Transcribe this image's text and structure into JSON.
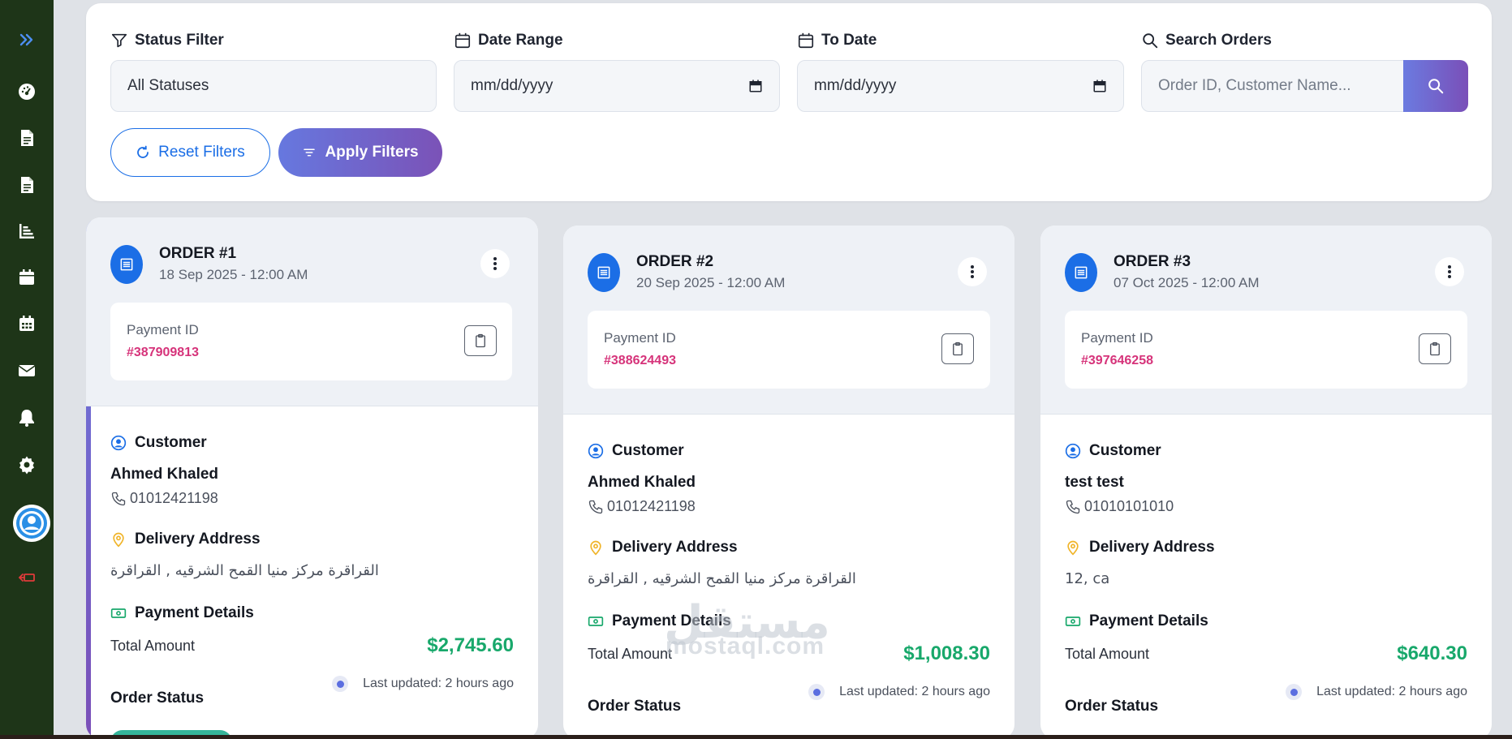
{
  "colors": {
    "sidebar_bg": "#1e3518",
    "primary_blue": "#1b6ee6",
    "gradient_start": "#6b7be0",
    "gradient_end": "#7a4fb8",
    "amount_green": "#18a86b",
    "payment_id_pink": "#d6337a"
  },
  "sidebar": {
    "icons": [
      "expand-icon",
      "dashboard-icon",
      "document-icon",
      "document-alt-icon",
      "chart-icon",
      "calendar-icon",
      "calendar-grid-icon",
      "mail-icon",
      "bell-icon",
      "settings-icon",
      "avatar",
      "logout-icon"
    ]
  },
  "filters": {
    "status_label": "Status Filter",
    "status_value": "All Statuses",
    "date_range_label": "Date Range",
    "date_range_placeholder": "mm/dd/yyyy",
    "to_date_label": "To Date",
    "to_date_placeholder": "mm/dd/yyyy",
    "search_label": "Search Orders",
    "search_placeholder": "Order ID, Customer Name...",
    "reset_label": "Reset Filters",
    "apply_label": "Apply Filters"
  },
  "orders": [
    {
      "title": "ORDER #1",
      "date": "18 Sep 2025 - 12:00 AM",
      "payment_label": "Payment ID",
      "payment_id": "#387909813",
      "customer_label": "Customer",
      "customer_name": "Ahmed Khaled",
      "phone": "01012421198",
      "address_label": "Delivery Address",
      "address": "القراقرة مركز منيا القمح الشرقيه , القراقرة",
      "payment_details_label": "Payment Details",
      "total_label": "Total Amount",
      "total": "$2,745.60",
      "updated": "Last updated: 2 hours ago",
      "status_label": "Order Status"
    },
    {
      "title": "ORDER #2",
      "date": "20 Sep 2025 - 12:00 AM",
      "payment_label": "Payment ID",
      "payment_id": "#388624493",
      "customer_label": "Customer",
      "customer_name": "Ahmed Khaled",
      "phone": "01012421198",
      "address_label": "Delivery Address",
      "address": "القراقرة مركز منيا القمح الشرقيه , القراقرة",
      "payment_details_label": "Payment Details",
      "total_label": "Total Amount",
      "total": "$1,008.30",
      "updated": "Last updated: 2 hours ago",
      "status_label": "Order Status"
    },
    {
      "title": "ORDER #3",
      "date": "07 Oct 2025 - 12:00 AM",
      "payment_label": "Payment ID",
      "payment_id": "#397646258",
      "customer_label": "Customer",
      "customer_name": "test test",
      "phone": "01010101010",
      "address_label": "Delivery Address",
      "address": "12, ca",
      "payment_details_label": "Payment Details",
      "total_label": "Total Amount",
      "total": "$640.30",
      "updated": "Last updated: 2 hours ago",
      "status_label": "Order Status"
    }
  ],
  "watermark": {
    "arabic": "مستقل",
    "latin": "mostaql.com"
  }
}
